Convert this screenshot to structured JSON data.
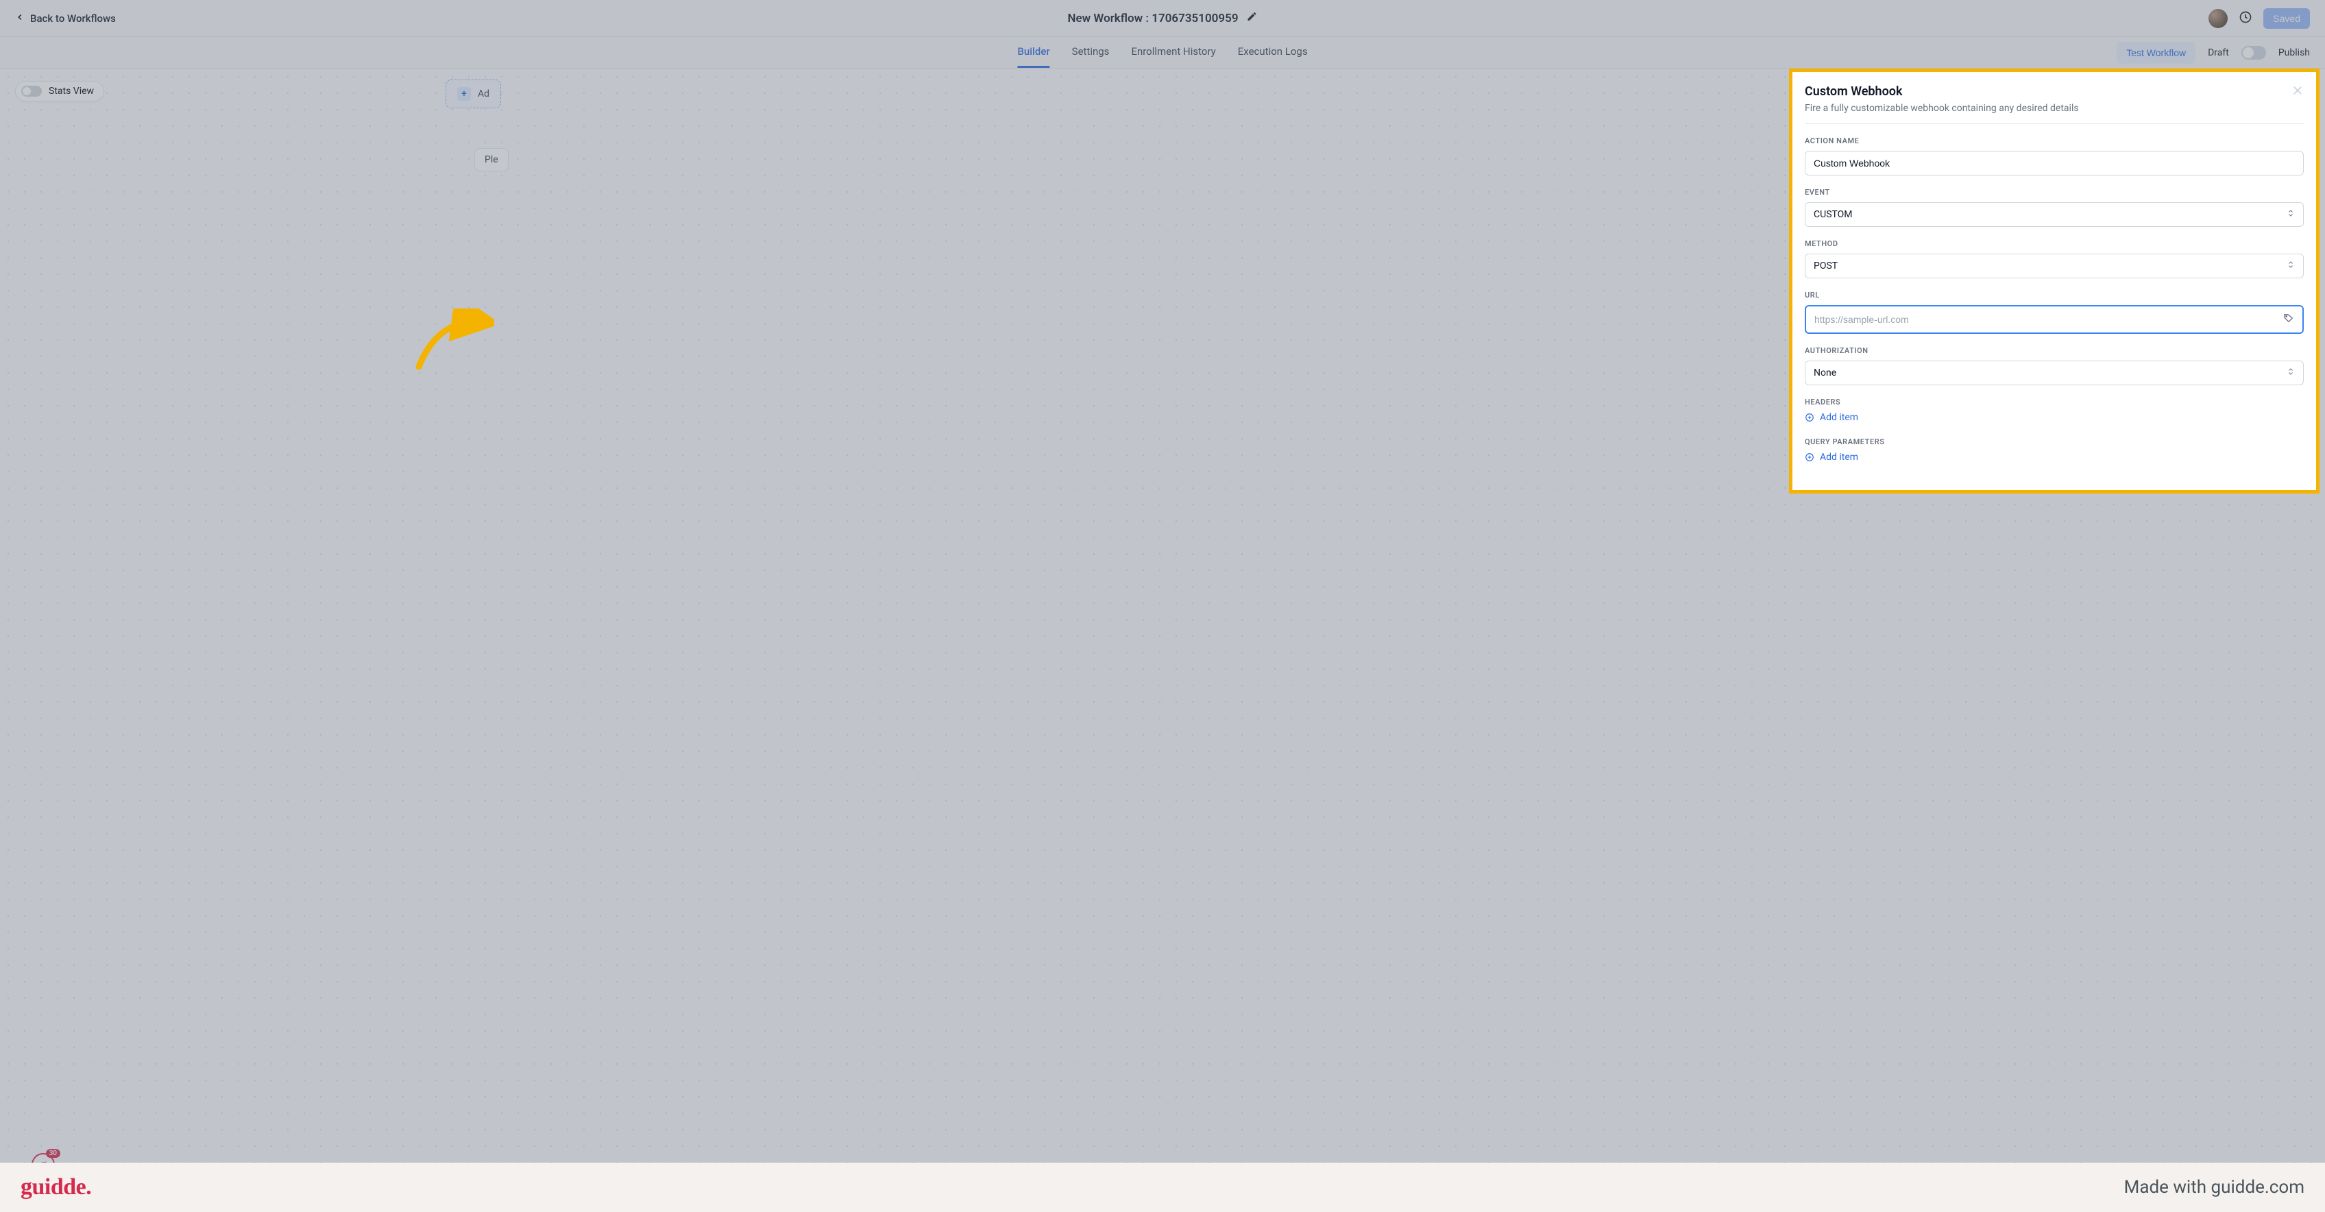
{
  "header": {
    "back_label": "Back to Workflows",
    "title": "New Workflow : 1706735100959",
    "saved_label": "Saved"
  },
  "tabs": {
    "builder": "Builder",
    "settings": "Settings",
    "enrollment": "Enrollment History",
    "execution": "Execution Logs",
    "test_workflow": "Test Workflow",
    "draft": "Draft",
    "publish": "Publish"
  },
  "canvas": {
    "stats_view": "Stats View",
    "add_label": "Ad",
    "ple_chip": "Ple",
    "badge_count": "30"
  },
  "panel": {
    "title": "Custom Webhook",
    "subtitle": "Fire a fully customizable webhook containing any desired details",
    "labels": {
      "action_name": "ACTION NAME",
      "event": "EVENT",
      "method": "METHOD",
      "url": "URL",
      "authorization": "AUTHORIZATION",
      "headers": "HEADERS",
      "query_parameters": "QUERY PARAMETERS"
    },
    "values": {
      "action_name": "Custom Webhook",
      "event": "CUSTOM",
      "method": "POST",
      "url_placeholder": "https://sample-url.com",
      "authorization": "None"
    },
    "add_item": "Add item"
  },
  "footer": {
    "logo": "guidde.",
    "made_with": "Made with guidde.com"
  }
}
